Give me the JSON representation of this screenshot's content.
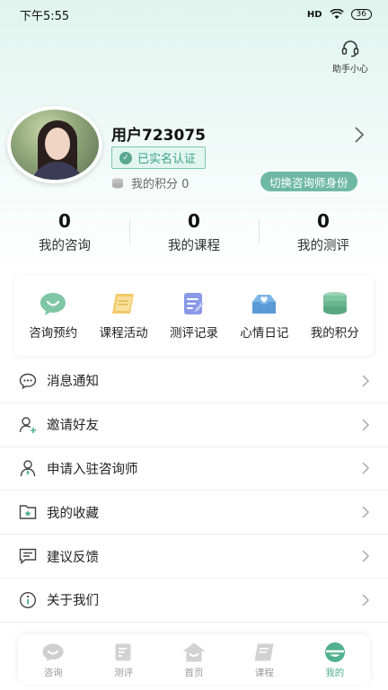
{
  "status_bar": {
    "time": "下午5:55",
    "signal": "HD",
    "battery": "36"
  },
  "header": {
    "helper_label": "助手小心"
  },
  "profile": {
    "username": "用户723075",
    "verified_label": "已实名认证",
    "points_label": "我的积分 0",
    "switch_role_label": "切换咨询师身份"
  },
  "stats": [
    {
      "value": "0",
      "label": "我的咨询"
    },
    {
      "value": "0",
      "label": "我的课程"
    },
    {
      "value": "0",
      "label": "我的测评"
    }
  ],
  "quick_actions": [
    {
      "label": "咨询预约",
      "icon": "chat-bubble-icon"
    },
    {
      "label": "课程活动",
      "icon": "book-icon"
    },
    {
      "label": "测评记录",
      "icon": "notepad-icon"
    },
    {
      "label": "心情日记",
      "icon": "mailbox-icon"
    },
    {
      "label": "我的积分",
      "icon": "coin-stack-icon"
    }
  ],
  "menu": [
    {
      "label": "消息通知",
      "icon": "message-icon"
    },
    {
      "label": "邀请好友",
      "icon": "add-friend-icon"
    },
    {
      "label": "申请入驻咨询师",
      "icon": "counselor-icon"
    },
    {
      "label": "我的收藏",
      "icon": "folder-star-icon"
    },
    {
      "label": "建议反馈",
      "icon": "feedback-icon"
    },
    {
      "label": "关于我们",
      "icon": "info-icon"
    }
  ],
  "tabbar": [
    {
      "label": "咨询",
      "active": false
    },
    {
      "label": "测评",
      "active": false
    },
    {
      "label": "首页",
      "active": false
    },
    {
      "label": "课程",
      "active": false
    },
    {
      "label": "我的",
      "active": true
    }
  ],
  "colors": {
    "accent": "#52b08f",
    "verified_bg": "#e3f5ef",
    "switch_bg": "#6fb9a4"
  }
}
